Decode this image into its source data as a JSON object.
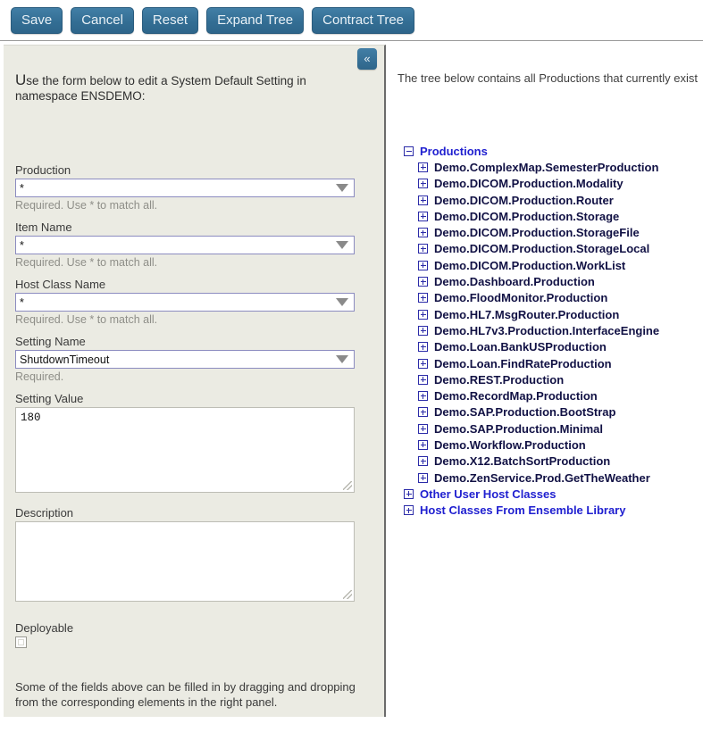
{
  "toolbar": {
    "buttons": [
      {
        "label": "Save",
        "name": "save-button"
      },
      {
        "label": "Cancel",
        "name": "cancel-button"
      },
      {
        "label": "Reset",
        "name": "reset-button"
      },
      {
        "label": "Expand Tree",
        "name": "expand-tree-button"
      },
      {
        "label": "Contract Tree",
        "name": "contract-tree-button"
      }
    ],
    "accent_color": "#336e94"
  },
  "left_panel": {
    "collapse_icon": "«",
    "intro_cap": "U",
    "intro_rest": "se the form below to edit a System Default Setting in namespace ENSDEMO:",
    "fields": {
      "production": {
        "label": "Production",
        "value": "*",
        "hint": "Required. Use * to match all."
      },
      "item_name": {
        "label": "Item Name",
        "value": "*",
        "hint": "Required. Use * to match all."
      },
      "host_class_name": {
        "label": "Host Class Name",
        "value": "*",
        "hint": "Required. Use * to match all."
      },
      "setting_name": {
        "label": "Setting Name",
        "value": "ShutdownTimeout",
        "hint": "Required."
      },
      "setting_value": {
        "label": "Setting Value",
        "value": "180"
      },
      "description": {
        "label": "Description",
        "value": ""
      },
      "deployable": {
        "label": "Deployable",
        "checked": false
      }
    },
    "drag_note": "Some of the fields above can be filled in by dragging and dropping from the corresponding elements in the right panel."
  },
  "right_panel": {
    "intro": "The tree below contains all Productions that currently exist",
    "tree": [
      {
        "label": "Productions",
        "level": 0,
        "state": "expanded",
        "style": "root"
      },
      {
        "label": "Demo.ComplexMap.SemesterProduction",
        "level": 1,
        "state": "collapsed",
        "style": "child"
      },
      {
        "label": "Demo.DICOM.Production.Modality",
        "level": 1,
        "state": "collapsed",
        "style": "child"
      },
      {
        "label": "Demo.DICOM.Production.Router",
        "level": 1,
        "state": "collapsed",
        "style": "child"
      },
      {
        "label": "Demo.DICOM.Production.Storage",
        "level": 1,
        "state": "collapsed",
        "style": "child"
      },
      {
        "label": "Demo.DICOM.Production.StorageFile",
        "level": 1,
        "state": "collapsed",
        "style": "child"
      },
      {
        "label": "Demo.DICOM.Production.StorageLocal",
        "level": 1,
        "state": "collapsed",
        "style": "child"
      },
      {
        "label": "Demo.DICOM.Production.WorkList",
        "level": 1,
        "state": "collapsed",
        "style": "child"
      },
      {
        "label": "Demo.Dashboard.Production",
        "level": 1,
        "state": "collapsed",
        "style": "child"
      },
      {
        "label": "Demo.FloodMonitor.Production",
        "level": 1,
        "state": "collapsed",
        "style": "child"
      },
      {
        "label": "Demo.HL7.MsgRouter.Production",
        "level": 1,
        "state": "collapsed",
        "style": "child"
      },
      {
        "label": "Demo.HL7v3.Production.InterfaceEngine",
        "level": 1,
        "state": "collapsed",
        "style": "child"
      },
      {
        "label": "Demo.Loan.BankUSProduction",
        "level": 1,
        "state": "collapsed",
        "style": "child"
      },
      {
        "label": "Demo.Loan.FindRateProduction",
        "level": 1,
        "state": "collapsed",
        "style": "child"
      },
      {
        "label": "Demo.REST.Production",
        "level": 1,
        "state": "collapsed",
        "style": "child"
      },
      {
        "label": "Demo.RecordMap.Production",
        "level": 1,
        "state": "collapsed",
        "style": "child"
      },
      {
        "label": "Demo.SAP.Production.BootStrap",
        "level": 1,
        "state": "collapsed",
        "style": "child"
      },
      {
        "label": "Demo.SAP.Production.Minimal",
        "level": 1,
        "state": "collapsed",
        "style": "child"
      },
      {
        "label": "Demo.Workflow.Production",
        "level": 1,
        "state": "collapsed",
        "style": "child"
      },
      {
        "label": "Demo.X12.BatchSortProduction",
        "level": 1,
        "state": "collapsed",
        "style": "child"
      },
      {
        "label": "Demo.ZenService.Prod.GetTheWeather",
        "level": 1,
        "state": "collapsed",
        "style": "child"
      },
      {
        "label": "Other User Host Classes",
        "level": 0,
        "state": "collapsed",
        "style": "root"
      },
      {
        "label": "Host Classes From Ensemble Library",
        "level": 0,
        "state": "collapsed",
        "style": "root"
      }
    ]
  }
}
